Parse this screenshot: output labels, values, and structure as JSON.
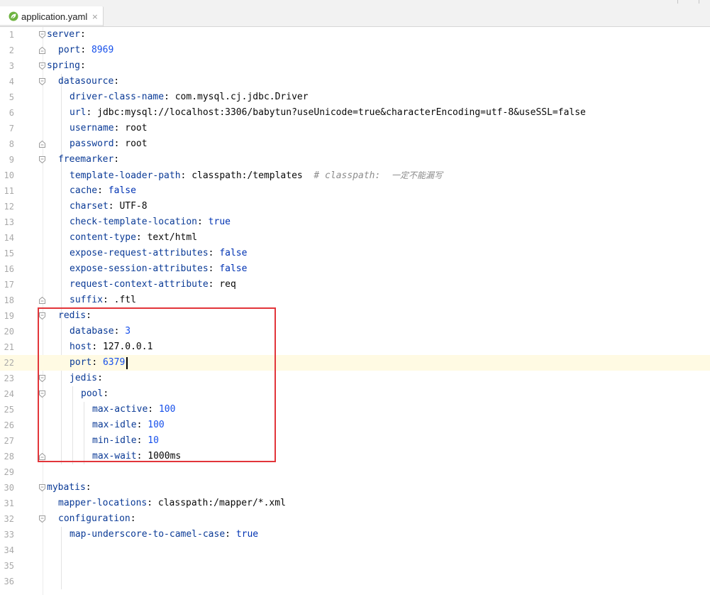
{
  "tab": {
    "filename": "application.yaml",
    "close": "×",
    "icon": "spring-leaf-icon"
  },
  "editor": {
    "lines": [
      {
        "n": "1",
        "parts": [
          [
            "k",
            "server"
          ],
          [
            "p",
            ":"
          ]
        ]
      },
      {
        "n": "2",
        "parts": [
          [
            "k",
            "port"
          ],
          [
            "p",
            ": "
          ],
          [
            "num",
            "8969"
          ]
        ]
      },
      {
        "n": "3",
        "parts": [
          [
            "k",
            "spring"
          ],
          [
            "p",
            ":"
          ]
        ]
      },
      {
        "n": "4",
        "parts": [
          [
            "k",
            "datasource"
          ],
          [
            "p",
            ":"
          ]
        ]
      },
      {
        "n": "5",
        "parts": [
          [
            "k",
            "driver-class-name"
          ],
          [
            "p",
            ": "
          ],
          [
            "v",
            "com.mysql.cj.jdbc.Driver"
          ]
        ]
      },
      {
        "n": "6",
        "parts": [
          [
            "k",
            "url"
          ],
          [
            "p",
            ": "
          ],
          [
            "v",
            "jdbc:mysql://localhost:3306/babytun?useUnicode=true&characterEncoding=utf-8&useSSL=false"
          ]
        ]
      },
      {
        "n": "7",
        "parts": [
          [
            "k",
            "username"
          ],
          [
            "p",
            ": "
          ],
          [
            "v",
            "root"
          ]
        ]
      },
      {
        "n": "8",
        "parts": [
          [
            "k",
            "password"
          ],
          [
            "p",
            ": "
          ],
          [
            "v",
            "root"
          ]
        ]
      },
      {
        "n": "9",
        "parts": [
          [
            "k",
            "freemarker"
          ],
          [
            "p",
            ":"
          ]
        ]
      },
      {
        "n": "10",
        "parts": [
          [
            "k",
            "template-loader-path"
          ],
          [
            "p",
            ": "
          ],
          [
            "v",
            "classpath:/templates  "
          ],
          [
            "cmt",
            "# classpath:  "
          ],
          [
            "cmt2",
            "一定不能漏写"
          ]
        ]
      },
      {
        "n": "11",
        "parts": [
          [
            "k",
            "cache"
          ],
          [
            "p",
            ": "
          ],
          [
            "bool",
            "false"
          ]
        ]
      },
      {
        "n": "12",
        "parts": [
          [
            "k",
            "charset"
          ],
          [
            "p",
            ": "
          ],
          [
            "v",
            "UTF-8"
          ]
        ]
      },
      {
        "n": "13",
        "parts": [
          [
            "k",
            "check-template-location"
          ],
          [
            "p",
            ": "
          ],
          [
            "bool",
            "true"
          ]
        ]
      },
      {
        "n": "14",
        "parts": [
          [
            "k",
            "content-type"
          ],
          [
            "p",
            ": "
          ],
          [
            "v",
            "text/html"
          ]
        ]
      },
      {
        "n": "15",
        "parts": [
          [
            "k",
            "expose-request-attributes"
          ],
          [
            "p",
            ": "
          ],
          [
            "bool",
            "false"
          ]
        ]
      },
      {
        "n": "16",
        "parts": [
          [
            "k",
            "expose-session-attributes"
          ],
          [
            "p",
            ": "
          ],
          [
            "bool",
            "false"
          ]
        ]
      },
      {
        "n": "17",
        "parts": [
          [
            "k",
            "request-context-attribute"
          ],
          [
            "p",
            ": "
          ],
          [
            "v",
            "req"
          ]
        ]
      },
      {
        "n": "18",
        "parts": [
          [
            "k",
            "suffix"
          ],
          [
            "p",
            ": "
          ],
          [
            "v",
            ".ftl"
          ]
        ]
      },
      {
        "n": "19",
        "parts": [
          [
            "k",
            "redis"
          ],
          [
            "p",
            ":"
          ]
        ]
      },
      {
        "n": "20",
        "parts": [
          [
            "k",
            "database"
          ],
          [
            "p",
            ": "
          ],
          [
            "num",
            "3"
          ]
        ]
      },
      {
        "n": "21",
        "parts": [
          [
            "k",
            "host"
          ],
          [
            "p",
            ": "
          ],
          [
            "v",
            "127.0.0.1"
          ]
        ]
      },
      {
        "n": "22",
        "parts": [
          [
            "k",
            "port"
          ],
          [
            "p",
            ": "
          ],
          [
            "num",
            "6379"
          ]
        ]
      },
      {
        "n": "23",
        "parts": [
          [
            "k",
            "jedis"
          ],
          [
            "p",
            ":"
          ]
        ]
      },
      {
        "n": "24",
        "parts": [
          [
            "k",
            "pool"
          ],
          [
            "p",
            ":"
          ]
        ]
      },
      {
        "n": "25",
        "parts": [
          [
            "k",
            "max-active"
          ],
          [
            "p",
            ": "
          ],
          [
            "num",
            "100"
          ]
        ]
      },
      {
        "n": "26",
        "parts": [
          [
            "k",
            "max-idle"
          ],
          [
            "p",
            ": "
          ],
          [
            "num",
            "100"
          ]
        ]
      },
      {
        "n": "27",
        "parts": [
          [
            "k",
            "min-idle"
          ],
          [
            "p",
            ": "
          ],
          [
            "num",
            "10"
          ]
        ]
      },
      {
        "n": "28",
        "parts": [
          [
            "k",
            "max-wait"
          ],
          [
            "p",
            ": "
          ],
          [
            "v",
            "1000ms"
          ]
        ]
      },
      {
        "n": "29",
        "parts": []
      },
      {
        "n": "30",
        "parts": [
          [
            "k",
            "mybatis"
          ],
          [
            "p",
            ":"
          ]
        ]
      },
      {
        "n": "31",
        "parts": [
          [
            "k",
            "mapper-locations"
          ],
          [
            "p",
            ": "
          ],
          [
            "v",
            "classpath:/mapper/*.xml"
          ]
        ]
      },
      {
        "n": "32",
        "parts": [
          [
            "k",
            "configuration"
          ],
          [
            "p",
            ":"
          ]
        ]
      },
      {
        "n": "33",
        "parts": [
          [
            "k",
            "map-underscore-to-camel-case"
          ],
          [
            "p",
            ": "
          ],
          [
            "bool",
            "true"
          ]
        ]
      },
      {
        "n": "34",
        "parts": []
      },
      {
        "n": "35",
        "parts": []
      },
      {
        "n": "36",
        "parts": []
      }
    ],
    "current_line": "22",
    "highlight": "redis-block"
  },
  "colors": {
    "key": "#0a3a96",
    "number": "#1750eb",
    "boolean": "#0033b3",
    "comment": "#8c8c8c",
    "current_line_bg": "#fffae3",
    "highlight_border": "#e2353a"
  }
}
